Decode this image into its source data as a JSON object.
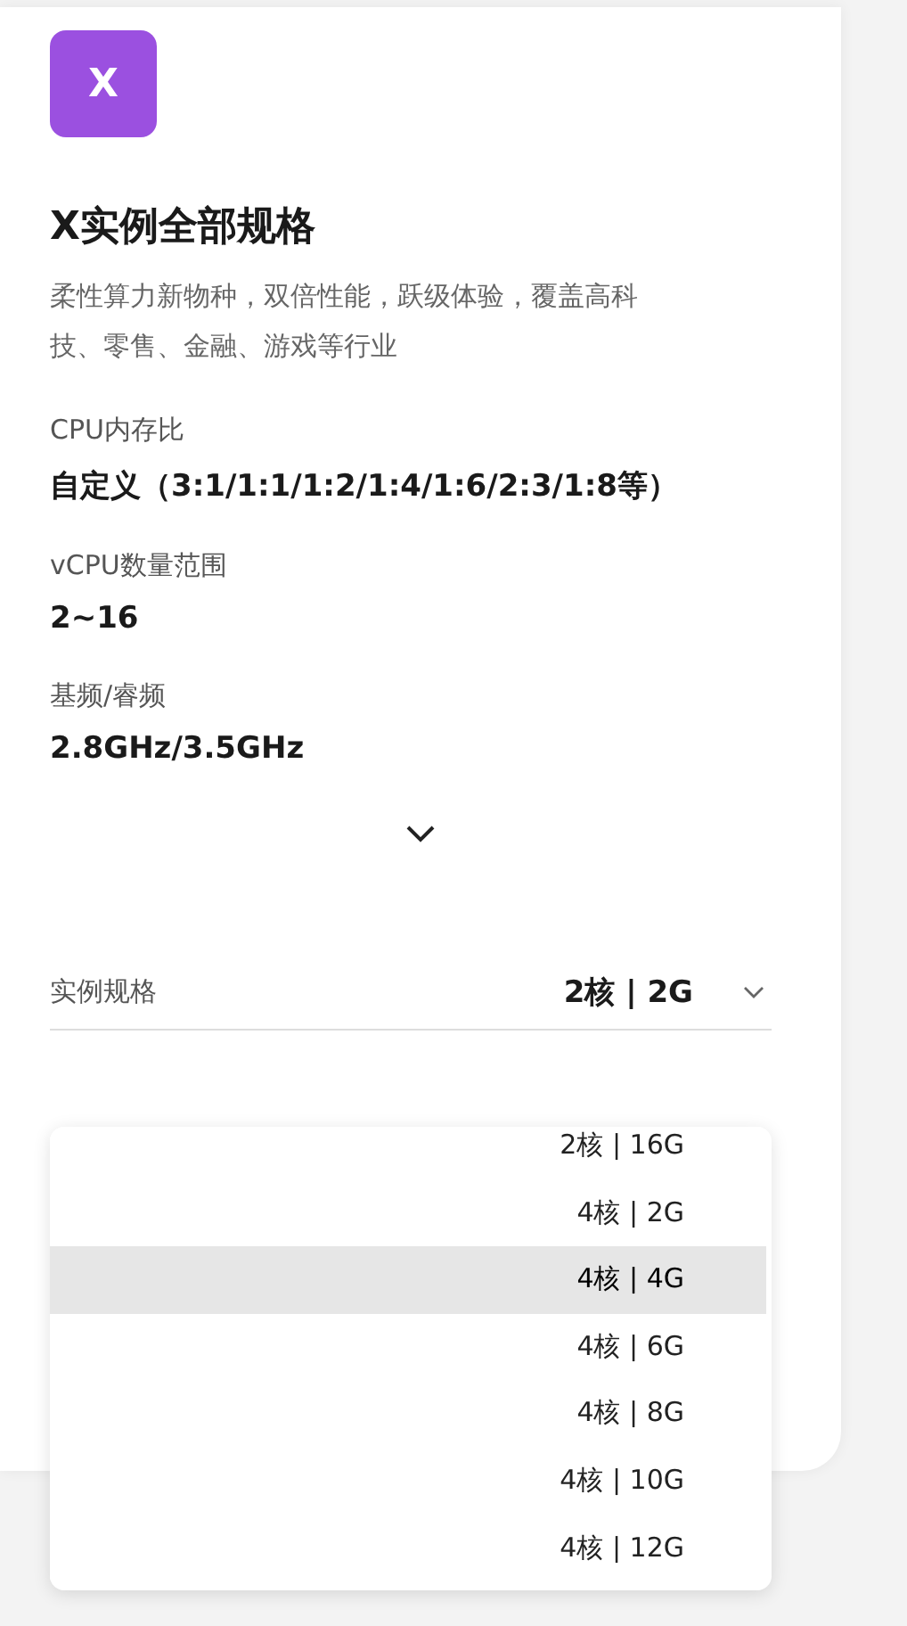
{
  "logo": {
    "letter": "X"
  },
  "title": "X实例全部规格",
  "description": "柔性算力新物种，双倍性能，跃级体验，覆盖高科技、零售、金融、游戏等行业",
  "specs": [
    {
      "label": "CPU内存比",
      "value": "自定义（3:1/1:1/1:2/1:4/1:6/2:3/1:8等）"
    },
    {
      "label": "vCPU数量范围",
      "value": "2~16"
    },
    {
      "label": "基频/睿频",
      "value": "2.8GHz/3.5GHz"
    }
  ],
  "select": {
    "label": "实例规格",
    "value": "2核 | 2G",
    "expanded": true
  },
  "options": [
    {
      "label": "2核 | 16G",
      "highlighted": false
    },
    {
      "label": "4核 | 2G",
      "highlighted": false
    },
    {
      "label": "4核 | 4G",
      "highlighted": true
    },
    {
      "label": "4核 | 6G",
      "highlighted": false
    },
    {
      "label": "4核 | 8G",
      "highlighted": false
    },
    {
      "label": "4核 | 10G",
      "highlighted": false
    },
    {
      "label": "4核 | 12G",
      "highlighted": false
    }
  ]
}
